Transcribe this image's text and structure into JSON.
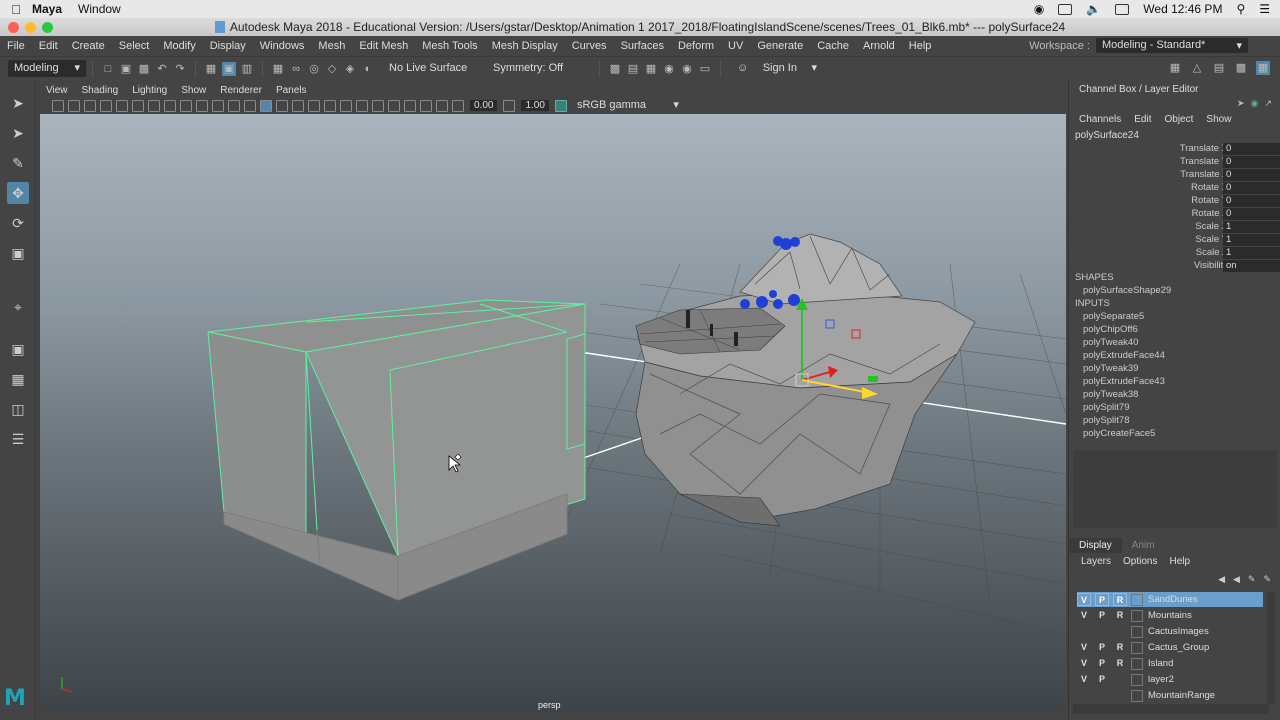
{
  "mac_menubar": {
    "app_name": "Maya",
    "menus": [
      "Window"
    ],
    "clock": "Wed 12:46 PM"
  },
  "window": {
    "title": "Autodesk Maya 2018 - Educational Version: /Users/gstar/Desktop/Animation 1 2017_2018/FloatingIslandScene/scenes/Trees_01_Blk6.mb*  ---  polySurface24"
  },
  "main_menu": [
    "File",
    "Edit",
    "Create",
    "Select",
    "Modify",
    "Display",
    "Windows",
    "Mesh",
    "Edit Mesh",
    "Mesh Tools",
    "Mesh Display",
    "Curves",
    "Surfaces",
    "Deform",
    "UV",
    "Generate",
    "Cache",
    "Arnold",
    "Help"
  ],
  "workspace": {
    "label": "Workspace :",
    "value": "Modeling - Standard*"
  },
  "status_line": {
    "mode": "Modeling",
    "live_surface": "No Live Surface",
    "symmetry": "Symmetry: Off",
    "sign_in": "Sign In"
  },
  "panel_menu": [
    "View",
    "Shading",
    "Lighting",
    "Show",
    "Renderer",
    "Panels"
  ],
  "panel_toolbar": {
    "exposure": "0.00",
    "gamma": "1.00",
    "color_space": "sRGB gamma"
  },
  "viewport": {
    "camera": "persp"
  },
  "channel_box": {
    "header": "Channel Box / Layer Editor",
    "tabs": [
      "Channels",
      "Edit",
      "Object",
      "Show"
    ],
    "object": "polySurface24",
    "attributes": [
      {
        "label": "Translate X",
        "value": "0"
      },
      {
        "label": "Translate Y",
        "value": "0"
      },
      {
        "label": "Translate Z",
        "value": "0"
      },
      {
        "label": "Rotate X",
        "value": "0"
      },
      {
        "label": "Rotate Y",
        "value": "0"
      },
      {
        "label": "Rotate Z",
        "value": "0"
      },
      {
        "label": "Scale X",
        "value": "1"
      },
      {
        "label": "Scale Y",
        "value": "1"
      },
      {
        "label": "Scale Z",
        "value": "1"
      },
      {
        "label": "Visibility",
        "value": "on"
      }
    ],
    "shapes_label": "SHAPES",
    "shape": "polySurfaceShape29",
    "inputs_label": "INPUTS",
    "inputs": [
      "polySeparate5",
      "polyChipOff6",
      "polyTweak40",
      "polyExtrudeFace44",
      "polyTweak39",
      "polyExtrudeFace43",
      "polyTweak38",
      "polySplit79",
      "polySplit78",
      "polyCreateFace5"
    ]
  },
  "layer_editor": {
    "tabs": [
      "Display",
      "Anim"
    ],
    "menus": [
      "Layers",
      "Options",
      "Help"
    ],
    "layers": [
      {
        "v": "V",
        "p": "P",
        "r": "R",
        "name": "SandDunes",
        "color": "#6a9ecb"
      },
      {
        "v": "V",
        "p": "P",
        "r": "R",
        "name": "Mountains",
        "color": ""
      },
      {
        "v": "",
        "p": "",
        "r": "",
        "name": "CactusImages",
        "color": ""
      },
      {
        "v": "V",
        "p": "P",
        "r": "R",
        "name": "Cactus_Group",
        "color": ""
      },
      {
        "v": "V",
        "p": "P",
        "r": "R",
        "name": "Island",
        "color": ""
      },
      {
        "v": "V",
        "p": "P",
        "r": "",
        "name": "layer2",
        "color": ""
      },
      {
        "v": "",
        "p": "",
        "r": "",
        "name": "MountainRange",
        "color": ""
      }
    ]
  },
  "colors": {
    "selection_wire": "#5cf2a0",
    "active_tool": "#5285a6",
    "layer_selected": "#6a9ecb",
    "maya_logo": "#1fa3b8"
  }
}
